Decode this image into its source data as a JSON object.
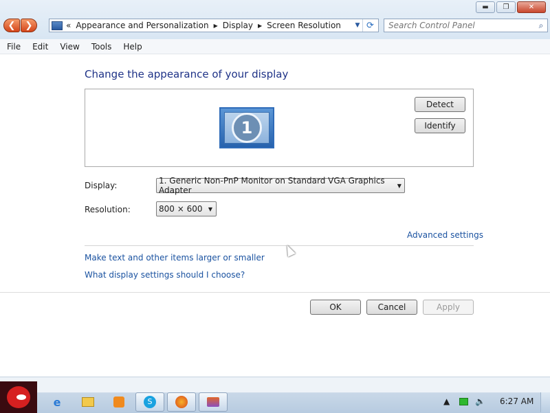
{
  "window": {
    "controls": {
      "minimize": "▬",
      "maximize": "❐",
      "close": "✕"
    },
    "nav": {
      "back_glyph": "❮",
      "forward_glyph": "❯"
    },
    "address": {
      "overflow": "«",
      "crumbs": [
        "Appearance and Personalization",
        "Display",
        "Screen Resolution"
      ]
    },
    "search": {
      "placeholder": "Search Control Panel"
    }
  },
  "menu": [
    "File",
    "Edit",
    "View",
    "Tools",
    "Help"
  ],
  "page": {
    "heading": "Change the appearance of your display",
    "monitor_number": "1",
    "detect_label": "Detect",
    "identify_label": "Identify",
    "display_label": "Display:",
    "display_value": "1. Generic Non-PnP Monitor on Standard VGA Graphics Adapter",
    "resolution_label": "Resolution:",
    "resolution_value": "800 × 600",
    "advanced_link": "Advanced settings",
    "text_size_link": "Make text and other items larger or smaller",
    "help_link": "What display settings should I choose?",
    "ok_label": "OK",
    "cancel_label": "Cancel",
    "apply_label": "Apply"
  },
  "taskbar": {
    "clock": "6:27 AM"
  },
  "colors": {
    "heading": "#1e3287",
    "link": "#1a52a0",
    "nav_orange": "#d4451a"
  }
}
